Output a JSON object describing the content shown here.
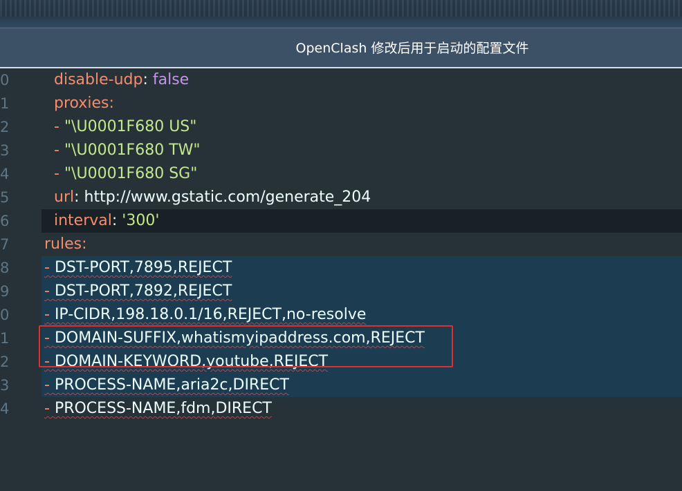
{
  "window": {
    "title": "OpenClash 修改后用于启动的配置文件"
  },
  "editor": {
    "lines": [
      {
        "num": "0",
        "key": "disable-udp",
        "sep": ": ",
        "value": "false"
      },
      {
        "num": "1",
        "key": "proxies",
        "sep": ":"
      },
      {
        "num": "2",
        "dash": "- ",
        "value": "\"\\U0001F680 US\""
      },
      {
        "num": "3",
        "dash": "- ",
        "value": "\"\\U0001F680 TW\""
      },
      {
        "num": "4",
        "dash": "- ",
        "value": "\"\\U0001F680 SG\""
      },
      {
        "num": "5",
        "key": "url",
        "sep": ": ",
        "value": "http://www.gstatic.com/generate_204"
      },
      {
        "num": "6",
        "key": "interval",
        "sep": ": ",
        "value": "'300'"
      },
      {
        "num": "7",
        "key": "rules",
        "sep": ":"
      },
      {
        "num": "8",
        "dash": "- ",
        "rule": "DST-PORT,7895,REJECT"
      },
      {
        "num": "9",
        "dash": "- ",
        "rule": "DST-PORT,7892,REJECT"
      },
      {
        "num": "0",
        "dash": "- ",
        "rule": "IP-CIDR,198.18.0.1/16,REJECT,no-resolve"
      },
      {
        "num": "1",
        "dash": "- ",
        "rule": "DOMAIN-SUFFIX,whatismyipaddress.com,REJECT"
      },
      {
        "num": "2",
        "dash": "- ",
        "rule": "DOMAIN-KEYWORD,youtube,REJECT"
      },
      {
        "num": "3",
        "dash": "- ",
        "rule": "PROCESS-NAME,aria2c,DIRECT"
      },
      {
        "num": "4",
        "dash": "- ",
        "rule": "PROCESS-NAME,fdm,DIRECT"
      }
    ]
  },
  "colors": {
    "editor_bg": "#263238",
    "selection_bg": "#1c3c52",
    "key": "#f78c6c",
    "string": "#c3e88d",
    "boolean": "#c792ea",
    "highlight_box": "#e0302c"
  }
}
